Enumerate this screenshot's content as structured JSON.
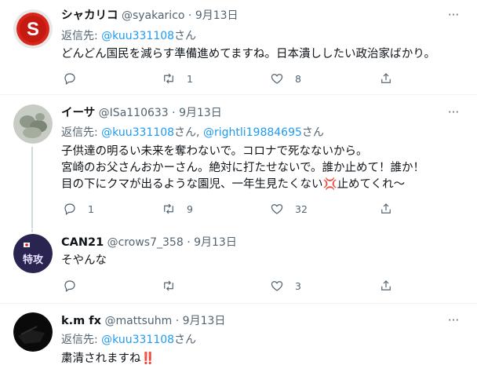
{
  "tweets": [
    {
      "name": "シャカリコ",
      "handle": "@syakarico",
      "dot": "·",
      "time": "9月13日",
      "reply_prefix": "返信先: ",
      "reply_mentions": "@kuu331108",
      "reply_suffix": "さん",
      "lines": [
        "どんどん国民を減らす準備進めてますね。日本潰ししたい政治家ばかり。"
      ],
      "reply_count": "",
      "retweet_count": "1",
      "like_count": "8"
    },
    {
      "name": "イーサ",
      "handle": "@ISa110633",
      "dot": "·",
      "time": "9月13日",
      "reply_prefix": "返信先: ",
      "reply_mentions": "@kuu331108",
      "reply_mid": "さん, ",
      "reply_mentions2": "@rightli19884695",
      "reply_suffix": "さん",
      "lines": [
        "子供達の明るい未来を奪わないで。コロナで死なないから。",
        "宮崎のお父さんおかーさん。絶対に打たせないで。誰か止めて！誰か！",
        "目の下にクマが出るような園児、一年生見たくない",
        "止めてくれ〜"
      ],
      "anger_emoji": "💢",
      "reply_count": "1",
      "retweet_count": "9",
      "like_count": "32"
    },
    {
      "name": "CAN21",
      "handle": "@crows7_358",
      "dot": "·",
      "time": "9月13日",
      "lines": [
        "そやんな"
      ],
      "reply_count": "",
      "retweet_count": "",
      "like_count": "3"
    },
    {
      "name": "k.m fx",
      "handle": "@mattsuhm",
      "dot": "·",
      "time": "9月13日",
      "reply_prefix": "返信先: ",
      "reply_mentions": "@kuu331108",
      "reply_suffix": "さん",
      "lines": [
        "粛清されますね"
      ],
      "exclaim_emoji": "‼️"
    }
  ],
  "icons": {
    "more": "more-dots-icon",
    "reply": "reply-icon",
    "retweet": "retweet-icon",
    "like": "like-heart-icon",
    "share": "share-icon"
  },
  "colors": {
    "link": "#1d9bf0",
    "secondary": "#536471",
    "separator": "#eff3f4"
  }
}
